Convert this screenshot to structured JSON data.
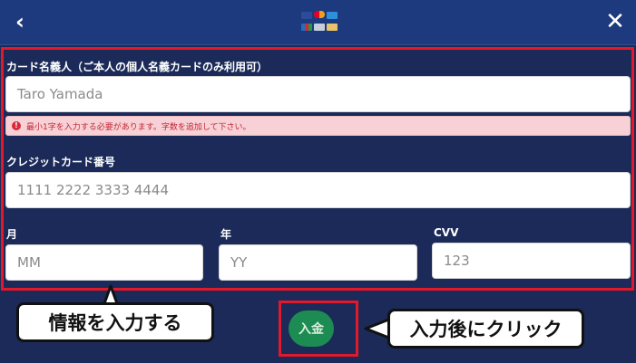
{
  "header": {
    "back_icon": "chevron-left-icon",
    "close_icon": "close-icon",
    "payment_logos": [
      "visa",
      "mastercard",
      "amex",
      "jcb",
      "card",
      "card"
    ]
  },
  "form": {
    "cardholder": {
      "label": "カード名義人（ご本人の個人名義カードのみ利用可）",
      "value": "Taro Yamada"
    },
    "error_message": "最小1字を入力する必要があります。字数を追加して下さい。",
    "card_number": {
      "label": "クレジットカード番号",
      "placeholder": "1111 2222 3333 4444"
    },
    "month": {
      "label": "月",
      "placeholder": "MM"
    },
    "year": {
      "label": "年",
      "placeholder": "YY"
    },
    "cvv": {
      "label": "CVV",
      "placeholder": "123"
    }
  },
  "submit": {
    "label": "入金"
  },
  "annotations": {
    "left_callout": "情報を入力する",
    "right_callout": "入力後にクリック"
  },
  "colors": {
    "header_bg": "#1e3a7e",
    "body_bg": "#1b2a59",
    "highlight": "#e3192a",
    "button": "#1c8c52",
    "error_bg": "#f7d1d5"
  }
}
